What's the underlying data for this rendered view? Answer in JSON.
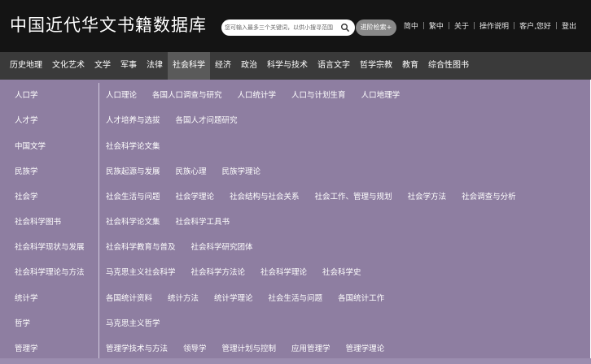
{
  "header": {
    "logo_text": "中国近代华文书籍数据库",
    "search_placeholder": "您可输入最多三个关键词，以供小搜寻范围",
    "advanced_search_label": "进阶检索+",
    "links": [
      "简中",
      "繁中",
      "关于",
      "操作说明",
      "客户,您好",
      "登出"
    ]
  },
  "nav": {
    "items": [
      "历史地理",
      "文化艺术",
      "文学",
      "军事",
      "法律",
      "社会科学",
      "经济",
      "政治",
      "科学与技术",
      "语言文字",
      "哲学宗教",
      "教育",
      "综合性图书"
    ],
    "active": "社会科学"
  },
  "categories": [
    {
      "name": "人口学",
      "subs": [
        "人口理论",
        "各国人口调查与研究",
        "人口统计学",
        "人口与计划生育",
        "人口地理学"
      ]
    },
    {
      "name": "人才学",
      "subs": [
        "人才培养与选拔",
        "各国人才问题研究"
      ]
    },
    {
      "name": "中国文学",
      "subs": [
        "社会科学论文集"
      ]
    },
    {
      "name": "民族学",
      "subs": [
        "民族起源与发展",
        "民族心理",
        "民族学理论"
      ]
    },
    {
      "name": "社会学",
      "subs": [
        "社会生活与问题",
        "社会学理论",
        "社会结构与社会关系",
        "社会工作、管理与规划",
        "社会学方法",
        "社会调查与分析"
      ]
    },
    {
      "name": "社会科学图书",
      "subs": [
        "社会科学论文集",
        "社会科学工具书"
      ]
    },
    {
      "name": "社会科学现状与发展",
      "subs": [
        "社会科学教育与普及",
        "社会科学研究团体"
      ]
    },
    {
      "name": "社会科学理论与方法",
      "subs": [
        "马克思主义社会科学",
        "社会科学方法论",
        "社会科学理论",
        "社会科学史"
      ]
    },
    {
      "name": "统计学",
      "subs": [
        "各国统计资料",
        "统计方法",
        "统计学理论",
        "社会生活与问题",
        "各国统计工作"
      ]
    },
    {
      "name": "哲学",
      "subs": [
        "马克思主义哲学"
      ]
    },
    {
      "name": "管理学",
      "subs": [
        "管理学技术与方法",
        "领导学",
        "管理计划与控制",
        "应用管理学",
        "管理学理论"
      ]
    }
  ],
  "colors": {
    "topbar": "#141414",
    "navbar": "#3a3a3a",
    "panel": "#8e7ea1"
  }
}
